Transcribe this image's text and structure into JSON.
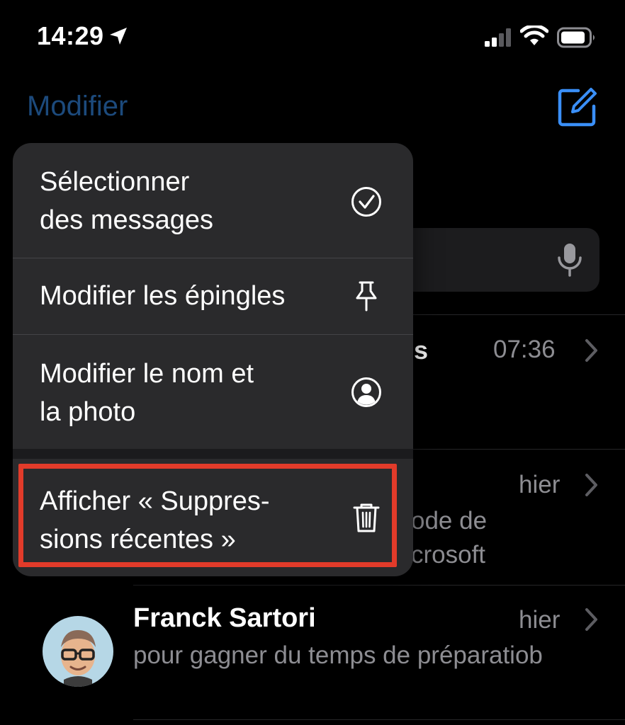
{
  "status_bar": {
    "time": "14:29",
    "icons": [
      "location-arrow-icon",
      "cellular-signal-icon",
      "wifi-icon",
      "battery-icon"
    ]
  },
  "nav": {
    "edit_label": "Modifier",
    "compose_icon": "compose-icon"
  },
  "menu": {
    "items": [
      {
        "line1": "Sélectionner",
        "line2": "des messages",
        "icon": "checkmark-circle-icon"
      },
      {
        "line1": "Modifier les épingles",
        "line2": "",
        "icon": "pin-icon"
      },
      {
        "line1": "Modifier le nom et",
        "line2": "la photo",
        "icon": "person-circle-icon"
      },
      {
        "line1": "Afficher « Suppres-",
        "line2": "sions récentes »",
        "icon": "trash-icon"
      }
    ]
  },
  "conversations": [
    {
      "name_fragment": "s",
      "time": "07:36",
      "preview": ""
    },
    {
      "time": "hier",
      "preview_line1": "ode de",
      "preview_line2": "crosoft"
    },
    {
      "name": "Franck Sartori",
      "time": "hier",
      "preview": "pour gagner du temps de préparatiob"
    }
  ],
  "colors": {
    "accent_dim": "#1c4a7c",
    "accent": "#3a8ff7",
    "highlight": "#e23b2a",
    "menu_bg": "#2a2a2c"
  }
}
